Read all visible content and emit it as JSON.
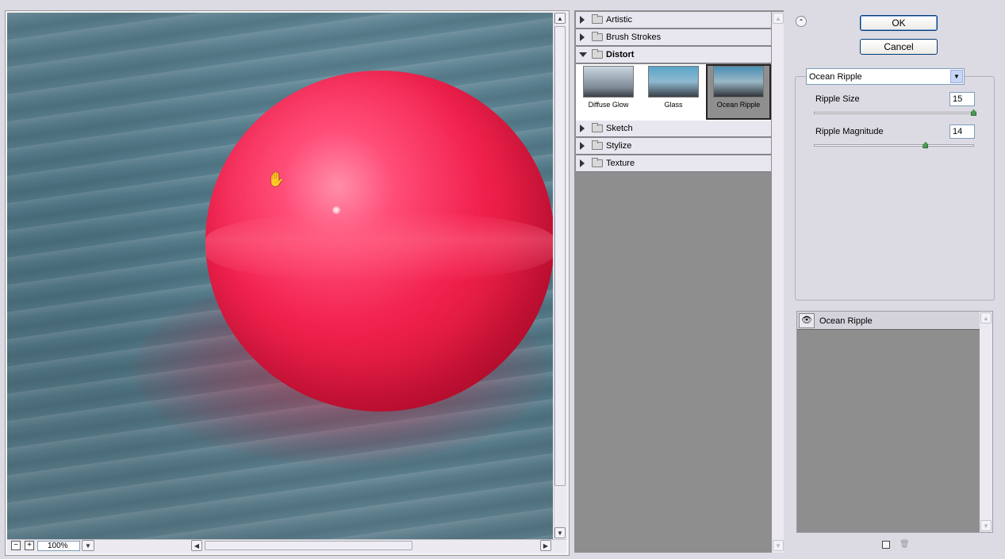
{
  "preview": {
    "zoom": "100%"
  },
  "gallery": {
    "categories": [
      {
        "label": "Artistic",
        "expanded": false
      },
      {
        "label": "Brush Strokes",
        "expanded": false
      },
      {
        "label": "Distort",
        "expanded": true
      },
      {
        "label": "Sketch",
        "expanded": false
      },
      {
        "label": "Stylize",
        "expanded": false
      },
      {
        "label": "Texture",
        "expanded": false
      }
    ],
    "distort_filters": [
      {
        "label": "Diffuse Glow",
        "selected": false
      },
      {
        "label": "Glass",
        "selected": false
      },
      {
        "label": "Ocean Ripple",
        "selected": true
      }
    ]
  },
  "buttons": {
    "ok": "OK",
    "cancel": "Cancel"
  },
  "settings": {
    "filter": "Ocean Ripple",
    "params": [
      {
        "label": "Ripple Size",
        "value": "15",
        "max": 15
      },
      {
        "label": "Ripple Magnitude",
        "value": "14",
        "max": 20
      }
    ]
  },
  "layers": {
    "items": [
      {
        "label": "Ocean Ripple",
        "visible": true
      }
    ]
  },
  "colors": {
    "ball": "#f2224e",
    "water": "#5e8898",
    "panel_bg": "#dcdbe3",
    "gallery_bg": "#8e8e8e"
  }
}
